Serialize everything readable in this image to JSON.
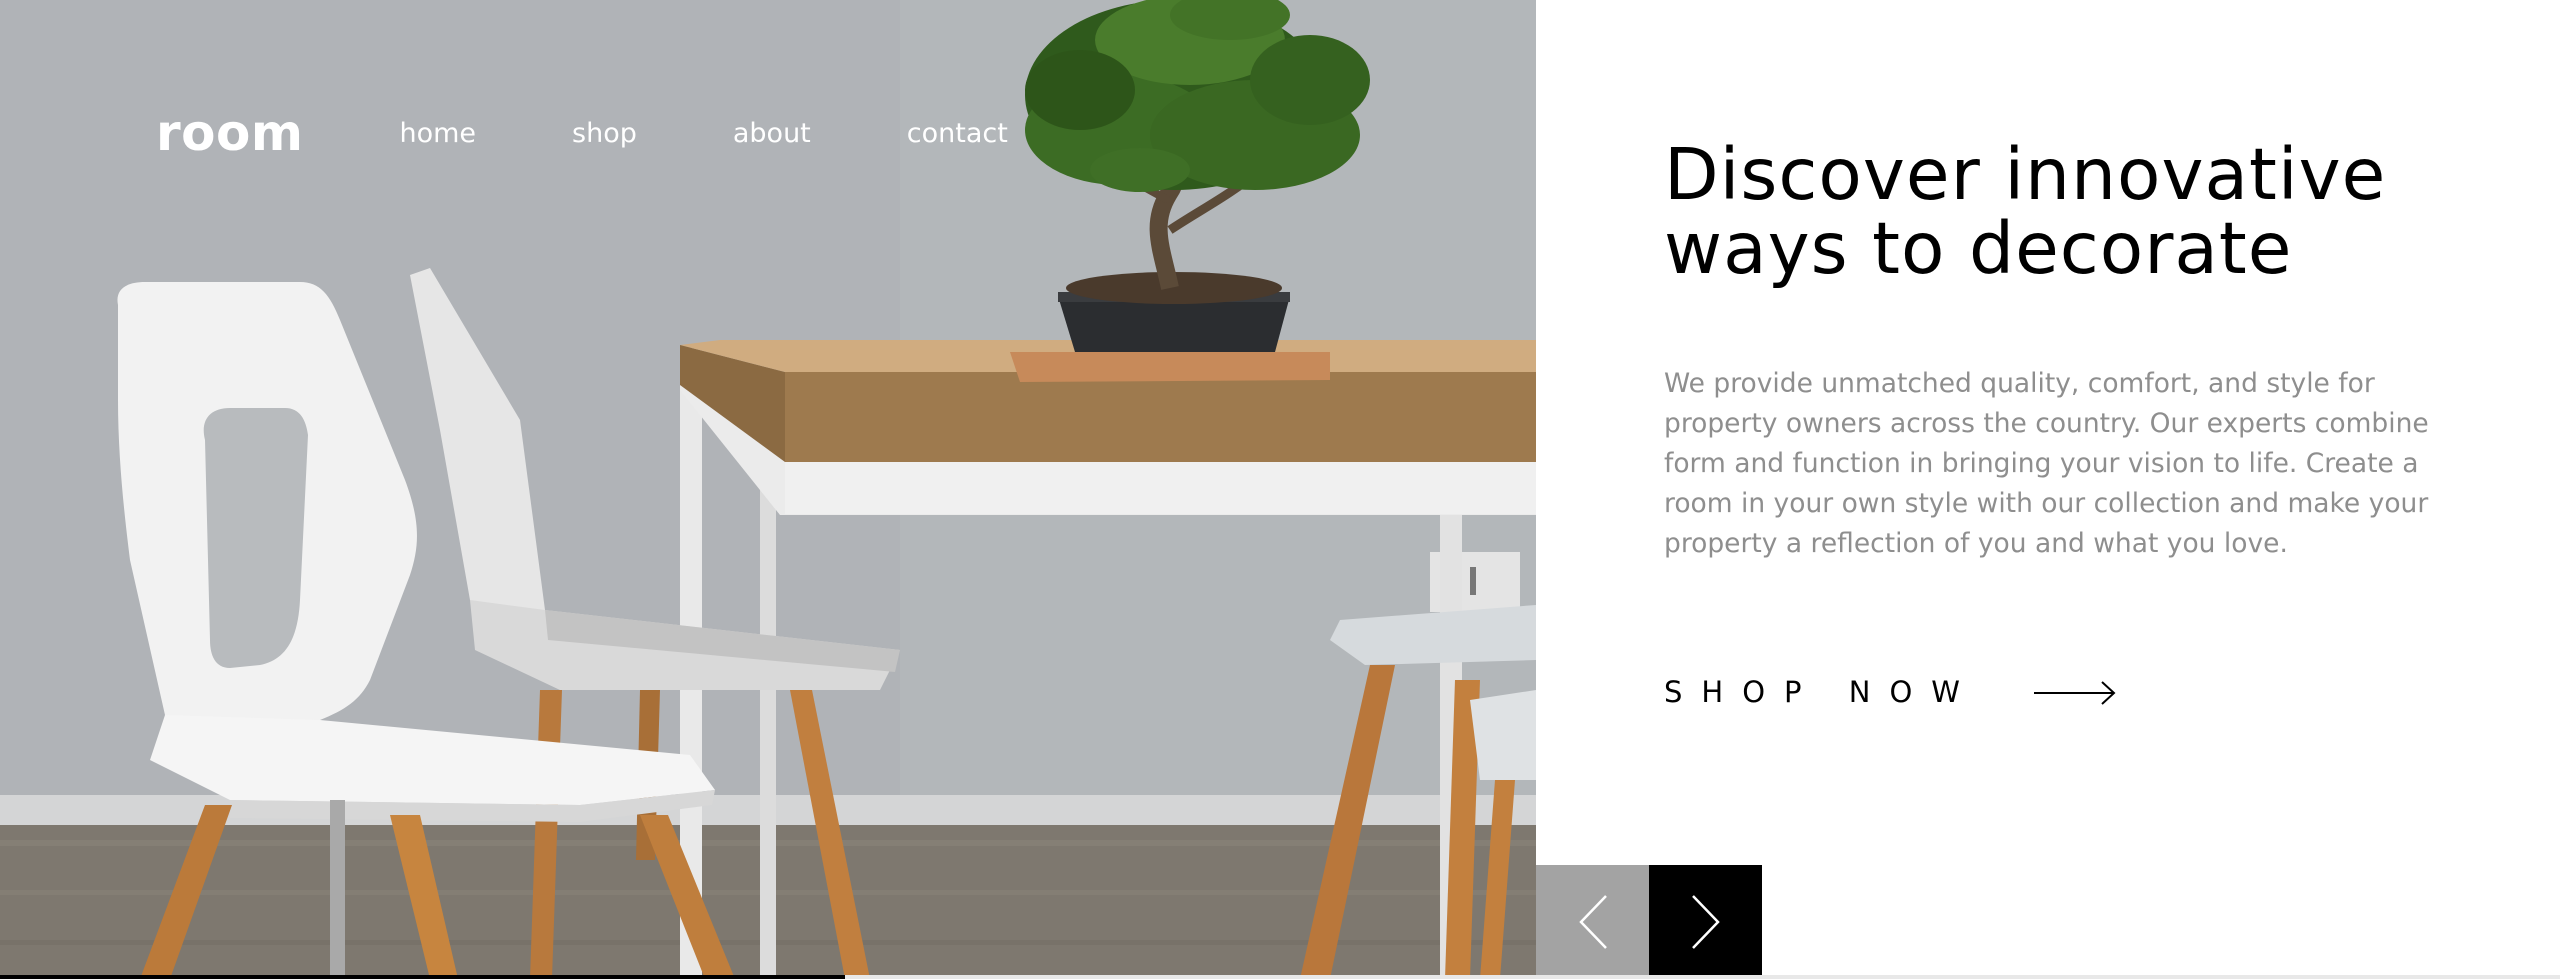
{
  "nav": {
    "logo": "room",
    "links": [
      "home",
      "shop",
      "about",
      "contact"
    ]
  },
  "hero": {
    "headline_line1": "Discover innovative",
    "headline_line2": "ways to decorate",
    "description": "We provide unmatched quality, comfort, and style for property owners across the country. Our experts combine form and function in bringing your vision to life. Create a room in your own style with our collection and make your property a reflection of you and what you love.",
    "cta_label": "SHOP NOW",
    "cta_icon": "arrow-right-icon"
  },
  "slider": {
    "prev_icon": "chevron-left-icon",
    "next_icon": "chevron-right-icon",
    "progress_fraction": 0.33
  },
  "colors": {
    "text_dark": "#000000",
    "text_muted": "#8e8e8e",
    "prev_button": "#a3a3a3",
    "next_button": "#000000",
    "background": "#ffffff"
  }
}
